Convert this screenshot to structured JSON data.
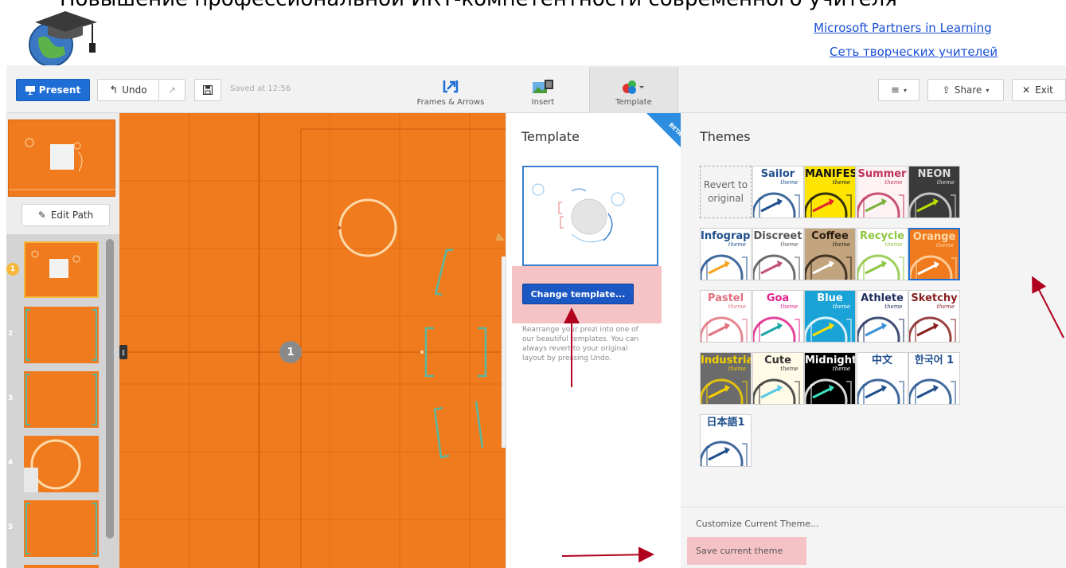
{
  "banner": {
    "title": "Повышение профессиональной ИКТ-компетентности современного учителя",
    "link1": "Microsoft Partners in Learning",
    "link2": "Сеть творческих учителей"
  },
  "toolbar": {
    "present_label": "Present",
    "undo_label": "Undo",
    "saved_text": "Saved at 12:56",
    "frames_label": "Frames & Arrows",
    "insert_label": "Insert",
    "template_label": "Template",
    "share_label": "Share",
    "exit_label": "Exit"
  },
  "left_panel": {
    "edit_path_label": "Edit Path",
    "slide_numbers": [
      "1",
      "2",
      "3",
      "4",
      "5"
    ]
  },
  "canvas": {
    "step_badge": "1"
  },
  "template_panel": {
    "title": "Template",
    "beta_label": "BETA",
    "change_button": "Change template...",
    "description": "Rearrange your prezi into one of our beautiful templates. You can always revert to your original layout by pressing Undo."
  },
  "themes_panel": {
    "title": "Themes",
    "revert_label": "Revert to original",
    "themes": [
      {
        "name": "Sailor",
        "sub": "theme",
        "bg": "#ffffff",
        "fg": "#1f4f8c",
        "accent": "#1f4f8c"
      },
      {
        "name": "MANIFESTO",
        "sub": "theme",
        "bg": "#ffe600",
        "fg": "#111111",
        "accent": "#e3262c"
      },
      {
        "name": "Summer",
        "sub": "theme",
        "bg": "#fdf3f5",
        "fg": "#c0345e",
        "accent": "#7ab03b"
      },
      {
        "name": "NEON",
        "sub": "theme",
        "bg": "#3a3a3a",
        "fg": "#dddddd",
        "accent": "#b7e000"
      },
      {
        "name": "Infographic",
        "sub": "theme",
        "bg": "#ffffff",
        "fg": "#1f4f8c",
        "accent": "#f6a21d"
      },
      {
        "name": "Discreet",
        "sub": "theme",
        "bg": "#ffffff",
        "fg": "#555555",
        "accent": "#c0507a"
      },
      {
        "name": "Coffee",
        "sub": "theme",
        "bg": "#c2a57f",
        "fg": "#2a1d12",
        "accent": "#ffffff"
      },
      {
        "name": "Recycle",
        "sub": "theme",
        "bg": "#ffffff",
        "fg": "#8dc63f",
        "accent": "#8dc63f"
      },
      {
        "name": "Orange",
        "sub": "theme",
        "bg": "#ef7b1e",
        "fg": "#ffd9a8",
        "accent": "#ffffff"
      },
      {
        "name": "Pastel",
        "sub": "theme",
        "bg": "#ffffff",
        "fg": "#e0717d",
        "accent": "#e0717d"
      },
      {
        "name": "Goa",
        "sub": "theme",
        "bg": "#ffffff",
        "fg": "#e0218a",
        "accent": "#1aa5a5"
      },
      {
        "name": "Blue",
        "sub": "theme",
        "bg": "#1aa3d6",
        "fg": "#ffffff",
        "accent": "#ffe000"
      },
      {
        "name": "Athlete",
        "sub": "theme",
        "bg": "#ffffff",
        "fg": "#1f2f5f",
        "accent": "#3a8fd6"
      },
      {
        "name": "Sketchy",
        "sub": "theme",
        "bg": "#ffffff",
        "fg": "#8a1f1f",
        "accent": "#8a1f1f"
      },
      {
        "name": "Industrial",
        "sub": "theme",
        "bg": "#6b6b6b",
        "fg": "#f6d000",
        "accent": "#f6d000"
      },
      {
        "name": "Cute",
        "sub": "theme",
        "bg": "#fffbe6",
        "fg": "#333333",
        "accent": "#56c6e6"
      },
      {
        "name": "Midnight",
        "sub": "theme",
        "bg": "#000000",
        "fg": "#ffffff",
        "accent": "#3fe0c0"
      },
      {
        "name": "中文",
        "sub": "",
        "bg": "#ffffff",
        "fg": "#1f4f8c",
        "accent": "#1f4f8c"
      },
      {
        "name": "한국어 1",
        "sub": "",
        "bg": "#ffffff",
        "fg": "#1f4f8c",
        "accent": "#1f4f8c"
      },
      {
        "name": "日本語1",
        "sub": "",
        "bg": "#ffffff",
        "fg": "#1f4f8c",
        "accent": "#1f4f8c"
      }
    ],
    "customize_label": "Customize Current Theme...",
    "save_label": "Save current theme"
  },
  "colors": {
    "canvas_orange": "#ef7b1e",
    "present_blue": "#1f6ed6",
    "highlight_pink": "#f5c2c6",
    "annotation_red": "#b0001e"
  }
}
